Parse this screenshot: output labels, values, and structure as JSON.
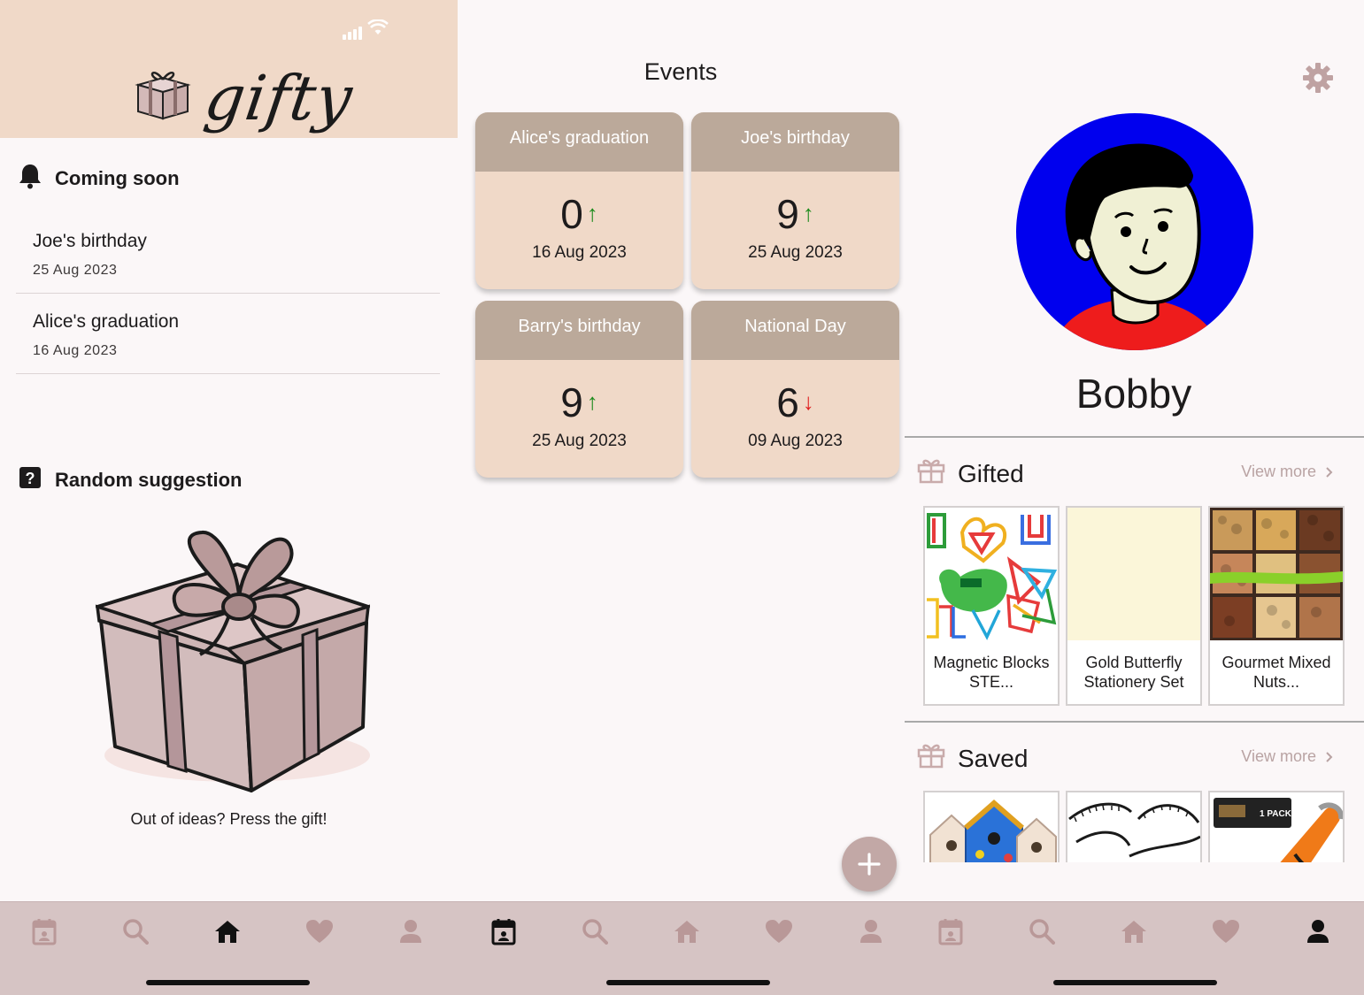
{
  "home": {
    "app_name": "gifty",
    "coming_soon_label": "Coming soon",
    "upcoming": [
      {
        "name": "Joe's birthday",
        "date": "25 Aug 2023"
      },
      {
        "name": "Alice's graduation",
        "date": "16 Aug 2023"
      }
    ],
    "random_label": "Random suggestion",
    "hint": "Out of ideas? Press the gift!"
  },
  "events": {
    "title": "Events",
    "cards": [
      {
        "name": "Alice's graduation",
        "count": "0",
        "trend": "up",
        "arrow": "↑",
        "date": "16 Aug 2023"
      },
      {
        "name": "Joe's birthday",
        "count": "9",
        "trend": "up",
        "arrow": "↑",
        "date": "25 Aug 2023"
      },
      {
        "name": "Barry's birthday",
        "count": "9",
        "trend": "up",
        "arrow": "↑",
        "date": "25 Aug 2023"
      },
      {
        "name": "National Day",
        "count": "6",
        "trend": "down",
        "arrow": "↓",
        "date": "09 Aug 2023"
      }
    ],
    "fab_icon": "plus-icon"
  },
  "profile": {
    "username": "Bobby",
    "gifted": {
      "label": "Gifted",
      "view_more": "View more",
      "items": [
        {
          "title": "Magnetic Blocks STE...",
          "image": "magnetic-blocks"
        },
        {
          "title": "Gold Butterfly Stationery Set",
          "image": "blank"
        },
        {
          "title": "Gourmet Mixed Nuts...",
          "image": "mixed-nuts"
        }
      ]
    },
    "saved": {
      "label": "Saved",
      "view_more": "View more",
      "items": [
        {
          "image": "birdhouses"
        },
        {
          "image": "headbands"
        },
        {
          "image": "flashlight",
          "badge": "1 PACK"
        }
      ]
    }
  },
  "nav": {
    "items": [
      "calendar-icon",
      "search-icon",
      "home-icon",
      "heart-icon",
      "person-icon"
    ],
    "active": {
      "home": "home-icon",
      "events": "calendar-icon",
      "profile": "person-icon"
    }
  },
  "colors": {
    "accent": "#f0d9c8",
    "card_header": "#bba99a",
    "nav_bg": "#d6c4c4",
    "nav_icon": "#b99898",
    "trend_up": "#1a8a1a",
    "trend_down": "#e02020",
    "avatar_bg": "#0000ee"
  }
}
